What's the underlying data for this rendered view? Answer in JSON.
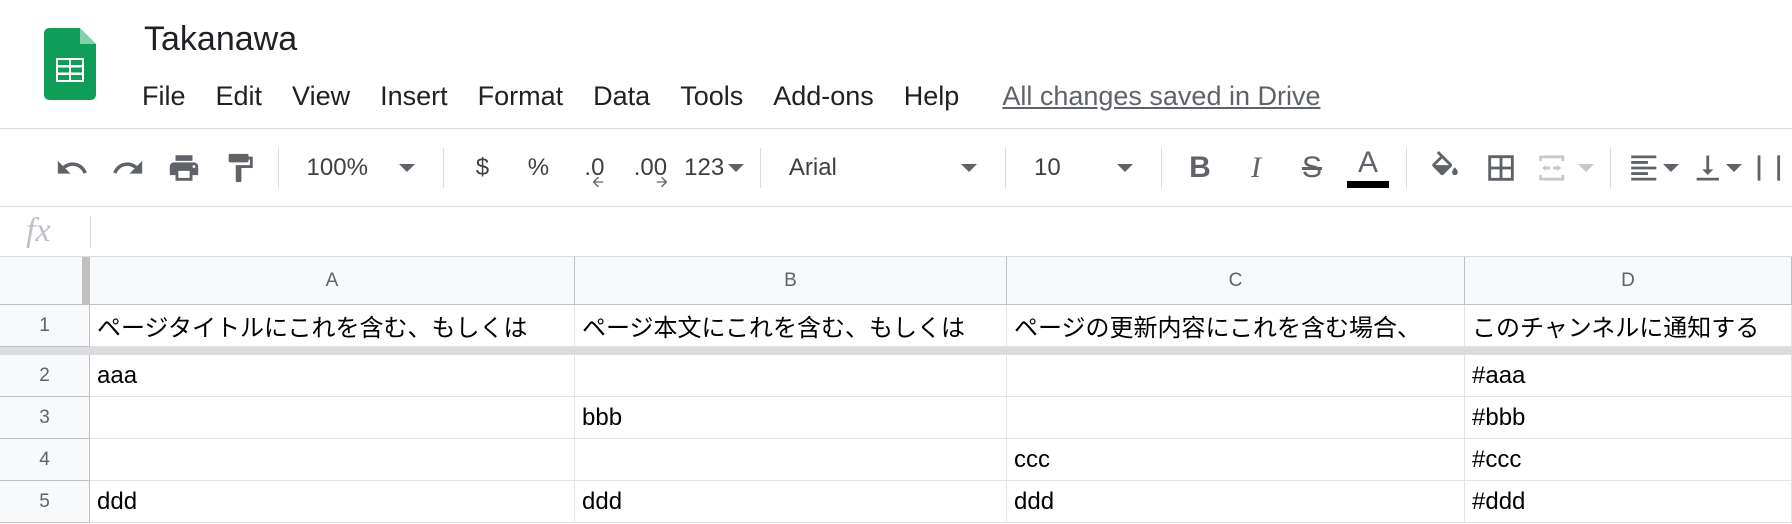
{
  "doc": {
    "title": "Takanawa"
  },
  "menu": {
    "items": [
      "File",
      "Edit",
      "View",
      "Insert",
      "Format",
      "Data",
      "Tools",
      "Add-ons",
      "Help"
    ],
    "save_status": "All changes saved in Drive"
  },
  "toolbar": {
    "zoom": "100%",
    "currency": "$",
    "percent": "%",
    "decimal_decrease": ".0",
    "decimal_increase": ".00",
    "number_format": "123",
    "font": "Arial",
    "font_size": "10",
    "bold": "B",
    "italic": "I",
    "strike": "S",
    "text_color_letter": "A",
    "text_color": "#000000"
  },
  "formula_bar": {
    "fx": "fx"
  },
  "grid": {
    "columns": [
      "A",
      "B",
      "C",
      "D"
    ],
    "rows": [
      {
        "num": "1",
        "cells": [
          "ページタイトルにこれを含む、もしくは",
          "ページ本文にこれを含む、もしくは",
          "ページの更新内容にこれを含む場合、",
          "このチャンネルに通知する"
        ]
      },
      {
        "num": "2",
        "cells": [
          "aaa",
          "",
          "",
          "#aaa"
        ]
      },
      {
        "num": "3",
        "cells": [
          "",
          "bbb",
          "",
          "#bbb"
        ]
      },
      {
        "num": "4",
        "cells": [
          "",
          "",
          "ccc",
          "#ccc"
        ]
      },
      {
        "num": "5",
        "cells": [
          "ddd",
          "ddd",
          "ddd",
          "#ddd"
        ]
      }
    ]
  },
  "colors": {
    "brand_green": "#0f9d58",
    "header_bg": "#f8f9fa"
  }
}
